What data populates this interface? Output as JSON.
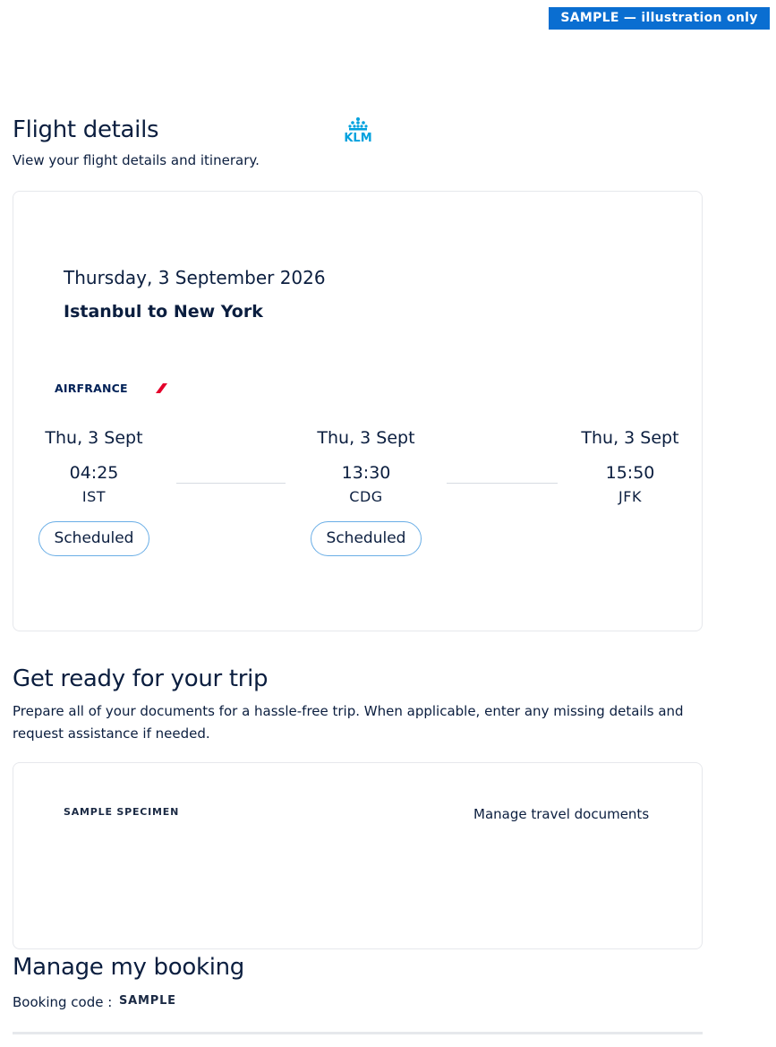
{
  "badge": {
    "text": "SAMPLE — illustration only"
  },
  "header": {
    "title": "Flight details",
    "subtitle": "View your flight details and itinerary.",
    "brand_logo_text": "KLM"
  },
  "flight": {
    "date": "Thursday, 3 September 2026",
    "route": "Istanbul to New York",
    "airline_logo_text": "AIRFRANCE",
    "stops": [
      {
        "day": "Thu, 3 Sept",
        "time": "04:25",
        "code": "IST",
        "status": "Scheduled"
      },
      {
        "day": "Thu, 3 Sept",
        "time": "13:30",
        "code": "CDG",
        "status": "Scheduled"
      },
      {
        "day": "Thu, 3 Sept",
        "time": "15:50",
        "code": "JFK"
      }
    ]
  },
  "trip_ready": {
    "title": "Get ready for your trip",
    "description": "Prepare all of your documents for a hassle-free trip. When applicable, enter any missing details and request assistance if needed.",
    "specimen_label": "SAMPLE SPECIMEN",
    "manage_docs_link": "Manage travel documents"
  },
  "manage_booking": {
    "title": "Manage my booking",
    "code_label": "Booking code :",
    "code_value": "SAMPLE"
  },
  "colors": {
    "brand_blue": "#0a6ed1",
    "klm_blue": "#00a1de",
    "airfrance_navy": "#002157",
    "airfrance_red": "#e4002b",
    "status_border": "#6aaee6",
    "text": "#0b1e3f"
  }
}
